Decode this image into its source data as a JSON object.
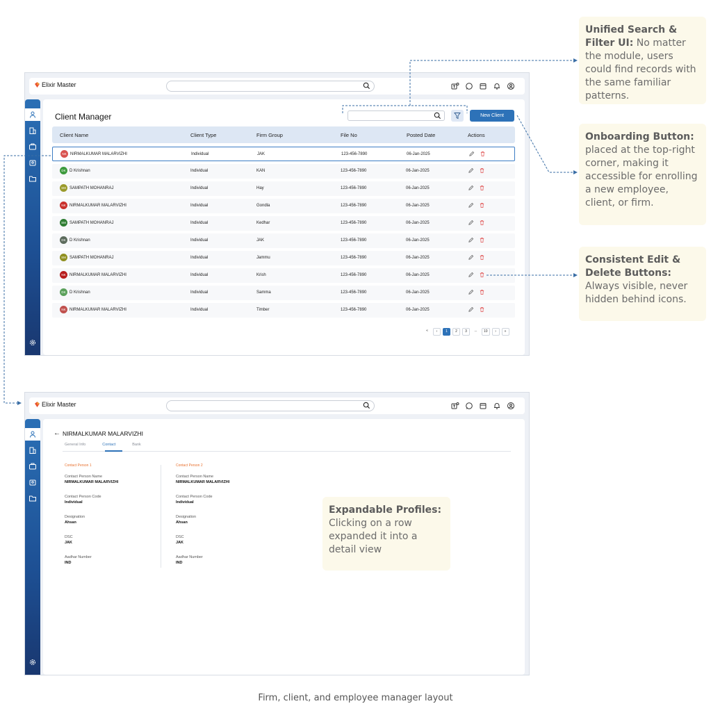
{
  "app": {
    "brand": "Elixir Master"
  },
  "client_manager": {
    "title": "Client Manager",
    "new_client_label": "New Client",
    "columns": [
      "Client Name",
      "Client Type",
      "Firm Group",
      "File No",
      "Posted Date",
      "Actions"
    ],
    "rows": [
      {
        "initials": "NK",
        "name": "NIRMALKUMAR MALARVIZHI",
        "type": "Individual",
        "group": "JAK",
        "file": "123-456-7890",
        "date": "06-Jan-2025",
        "avatar_color": "#d9534f"
      },
      {
        "initials": "DK",
        "name": "D Krishnan",
        "type": "Individual",
        "group": "KAN",
        "file": "123-456-7890",
        "date": "06-Jan-2025",
        "avatar_color": "#3d9a3d"
      },
      {
        "initials": "SM",
        "name": "SAMPATH MOHANRAJ",
        "type": "Individual",
        "group": "Hay",
        "file": "123-456-7890",
        "date": "06-Jan-2025",
        "avatar_color": "#9a9a2a"
      },
      {
        "initials": "NK",
        "name": "NIRMALKUMAR MALARVIZHI",
        "type": "Individual",
        "group": "Gondla",
        "file": "123-456-7890",
        "date": "06-Jan-2025",
        "avatar_color": "#c9302c"
      },
      {
        "initials": "SM",
        "name": "SAMPATH MOHANRAJ",
        "type": "Individual",
        "group": "Kedhar",
        "file": "123-456-7890",
        "date": "06-Jan-2025",
        "avatar_color": "#2e7d32"
      },
      {
        "initials": "DK",
        "name": "D Krishnan",
        "type": "Individual",
        "group": "JAK",
        "file": "123-456-7890",
        "date": "06-Jan-2025",
        "avatar_color": "#5c6b5c"
      },
      {
        "initials": "SM",
        "name": "SAMPATH MOHANRAJ",
        "type": "Individual",
        "group": "Jammu",
        "file": "123-456-7890",
        "date": "06-Jan-2025",
        "avatar_color": "#8f8f1f"
      },
      {
        "initials": "NK",
        "name": "NIRMALKUMAR MALARVIZHI",
        "type": "Individual",
        "group": "Krish",
        "file": "123-456-7890",
        "date": "06-Jan-2025",
        "avatar_color": "#b71c1c"
      },
      {
        "initials": "DK",
        "name": "D Krishnan",
        "type": "Individual",
        "group": "Samma",
        "file": "123-456-7890",
        "date": "06-Jan-2025",
        "avatar_color": "#5aa05a"
      },
      {
        "initials": "NK",
        "name": "NIRMALKUMAR MALARVIZHI",
        "type": "Individual",
        "group": "Timber",
        "file": "123-456-7890",
        "date": "06-Jan-2025",
        "avatar_color": "#c0504d"
      }
    ],
    "pagination": [
      "«",
      "‹",
      "1",
      "2",
      "3",
      "...",
      "10",
      "›",
      "»"
    ],
    "current_page": "1"
  },
  "detail": {
    "name": "NIRMALKUMAR MALARVIZHI",
    "back_glyph": "←",
    "tabs": [
      "General Info",
      "Contact",
      "Bank"
    ],
    "active_tab": "Contact",
    "contacts": [
      {
        "title": "Contact Person 1",
        "fields": [
          {
            "label": "Contact Person Name",
            "value": "NIRMALKUMAR MALARVIZHI"
          },
          {
            "label": "Contact Person Code",
            "value": "Individual"
          },
          {
            "label": "Designation",
            "value": "Ahsan"
          },
          {
            "label": "DSC",
            "value": "JAK"
          },
          {
            "label": "Aadhar Number",
            "value": "IND"
          }
        ]
      },
      {
        "title": "Contact Person 2",
        "fields": [
          {
            "label": "Contact Person Name",
            "value": "NIRMALKUMAR MALARVIZHI"
          },
          {
            "label": "Contact Person Code",
            "value": "Individual"
          },
          {
            "label": "Designation",
            "value": "Ahsan"
          },
          {
            "label": "DSC",
            "value": "JAK"
          },
          {
            "label": "Aadhar Number",
            "value": "IND"
          }
        ]
      }
    ]
  },
  "annotations": {
    "search": {
      "bold": "Unified Search & Filter UI:",
      "text": " No matter the module, users could find records with the same familiar patterns."
    },
    "onboarding": {
      "bold": "Onboarding Button:",
      "text": " placed at the top-right corner, making it accessible for enrolling a new employee, client, or firm."
    },
    "edit_delete": {
      "bold": "Consistent Edit & Delete Buttons:",
      "text": " Always visible, never hidden behind icons."
    },
    "expandable": {
      "bold": "Expandable Profiles:",
      "text": " Clicking on a row expanded it into a detail view"
    }
  },
  "caption": "Firm, client, and employee manager layout",
  "colors": {
    "primary": "#2d72b8",
    "sidebar": "#1d4f93",
    "accent_orange": "#e8712f",
    "delete_red": "#e05252",
    "note_bg": "#fcf9ea"
  }
}
